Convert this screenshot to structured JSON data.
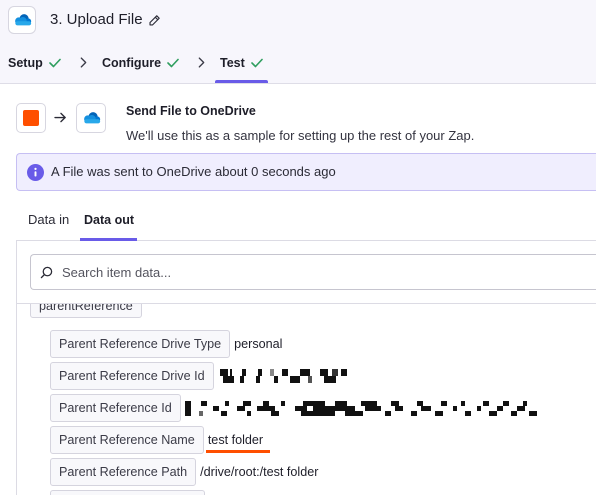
{
  "colors": {
    "accent": "#695be8",
    "success": "#2f9e5f",
    "brand": "#ff4f00",
    "highlight": "#ff4f00",
    "banner_bg": "#f0eefe"
  },
  "icons": {
    "step_app": "onedrive-icon",
    "edit": "pencil-icon",
    "tab_complete": "check-icon",
    "tab_separator": "chevron-right-icon",
    "trigger_app": "orange-square-icon",
    "flow": "arrow-right-icon",
    "action_app": "onedrive-icon",
    "banner": "info-icon",
    "search": "search-icon"
  },
  "header": {
    "step_title": "3. Upload File"
  },
  "tabs": [
    {
      "label": "Setup",
      "complete": true
    },
    {
      "label": "Configure",
      "complete": true
    },
    {
      "label": "Test",
      "complete": true,
      "active": true
    }
  ],
  "action": {
    "title": "Send File to OneDrive",
    "subtitle": "We'll use this as a sample for setting up the rest of your Zap."
  },
  "banner": {
    "message": "A File was sent to OneDrive about 0 seconds ago"
  },
  "data_tabs": [
    {
      "label": "Data in"
    },
    {
      "label": "Data out",
      "active": true
    }
  ],
  "search": {
    "placeholder": "Search item data..."
  },
  "data_out": {
    "group": "parentReference",
    "rows": [
      {
        "key": "Parent Reference Drive Type",
        "value": "personal"
      },
      {
        "key": "Parent Reference Drive Id",
        "value": null,
        "redacted": true
      },
      {
        "key": "Parent Reference Id",
        "value": null,
        "redacted": true
      },
      {
        "key": "Parent Reference Name",
        "value": "test folder",
        "highlighted": true
      },
      {
        "key": "Parent Reference Path",
        "value": "/drive/root:/test folder"
      }
    ]
  }
}
